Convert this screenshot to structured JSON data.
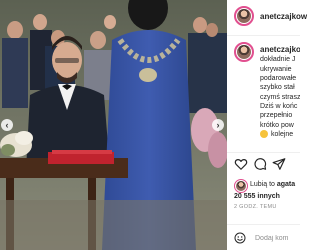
{
  "post": {
    "username": "anetczajkow",
    "caption_lines": [
      "dokładnie J",
      "ukrywanie",
      "podarowałe",
      "szybko stał",
      "czymś strasz",
      "Dziś w końc",
      "przepełnio",
      "krótko pow",
      "kolejne"
    ],
    "likes": {
      "prefix": "Lubią to",
      "liker": "agata",
      "count": "20 555",
      "suffix": "innych"
    },
    "timestamp": "2 GODZ. TEMU",
    "comment_placeholder": "Dodaj kom"
  },
  "colors": {
    "story_ring": "#e14f8f",
    "dress": "#3b57a8",
    "table": "#4a2c1a",
    "folder": "#c0232e"
  },
  "icons": [
    "heart-icon",
    "comment-icon",
    "share-icon",
    "smile-icon",
    "chevron-left-icon",
    "chevron-right-icon"
  ]
}
